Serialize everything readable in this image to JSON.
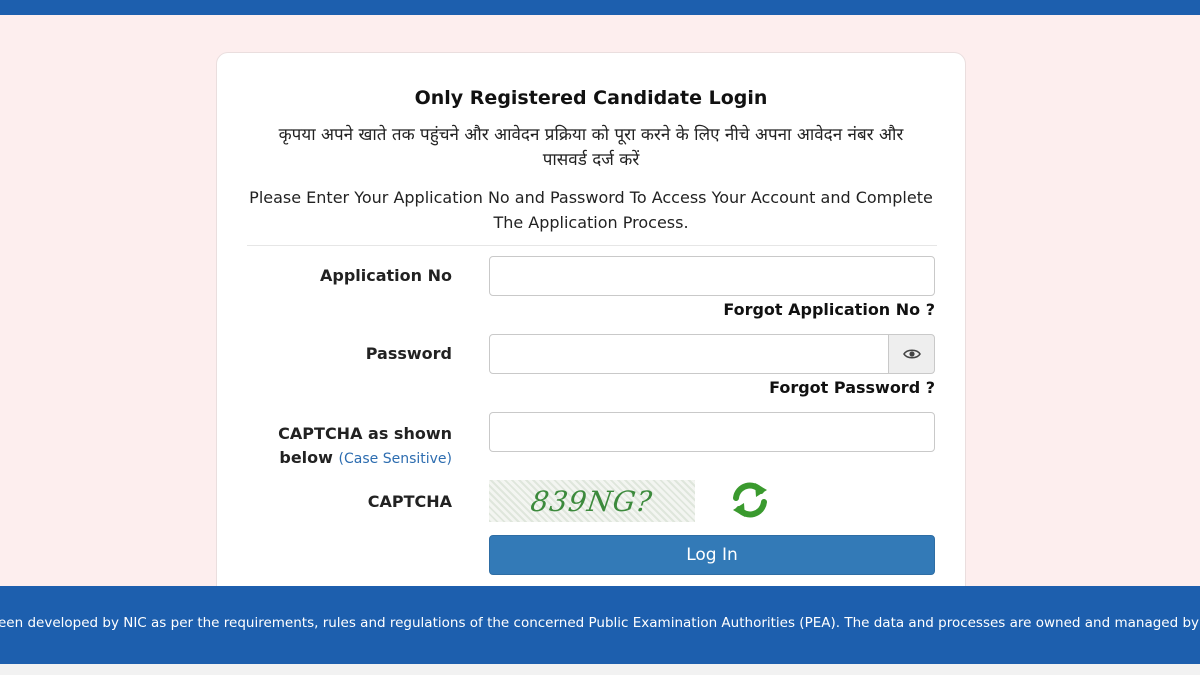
{
  "login": {
    "title": "Only Registered Candidate Login",
    "hindi_instruction": "कृपया अपने खाते तक पहुंचने और आवेदन प्रक्रिया को पूरा करने के लिए नीचे अपना आवेदन नंबर और पासवर्ड दर्ज करें",
    "english_instruction": "Please Enter Your Application No and Password To Access Your Account and Complete The Application Process.",
    "application_no_label": "Application No",
    "application_no_value": "",
    "forgot_application_label": "Forgot Application No ?",
    "password_label": "Password",
    "password_value": "",
    "forgot_password_label": "Forgot Password ?",
    "captcha_input_label": "CAPTCHA as shown below",
    "captcha_input_hint": "(Case Sensitive)",
    "captcha_input_value": "",
    "captcha_label": "CAPTCHA",
    "captcha_text": "839NG?",
    "login_button_label": "Log In"
  },
  "footer": {
    "text": "een developed by NIC as per the requirements, rules and regulations of the concerned Public Examination Authorities (PEA). The data and processes are owned and managed by"
  },
  "icons": {
    "password_toggle": "eye-icon",
    "captcha_refresh": "refresh-icon"
  },
  "colors": {
    "header_bar": "#1d5fae",
    "page_background": "#fdeeee",
    "login_button": "#337ab7",
    "hint_text": "#2d6db0",
    "captcha_text": "#3c8a3c"
  }
}
